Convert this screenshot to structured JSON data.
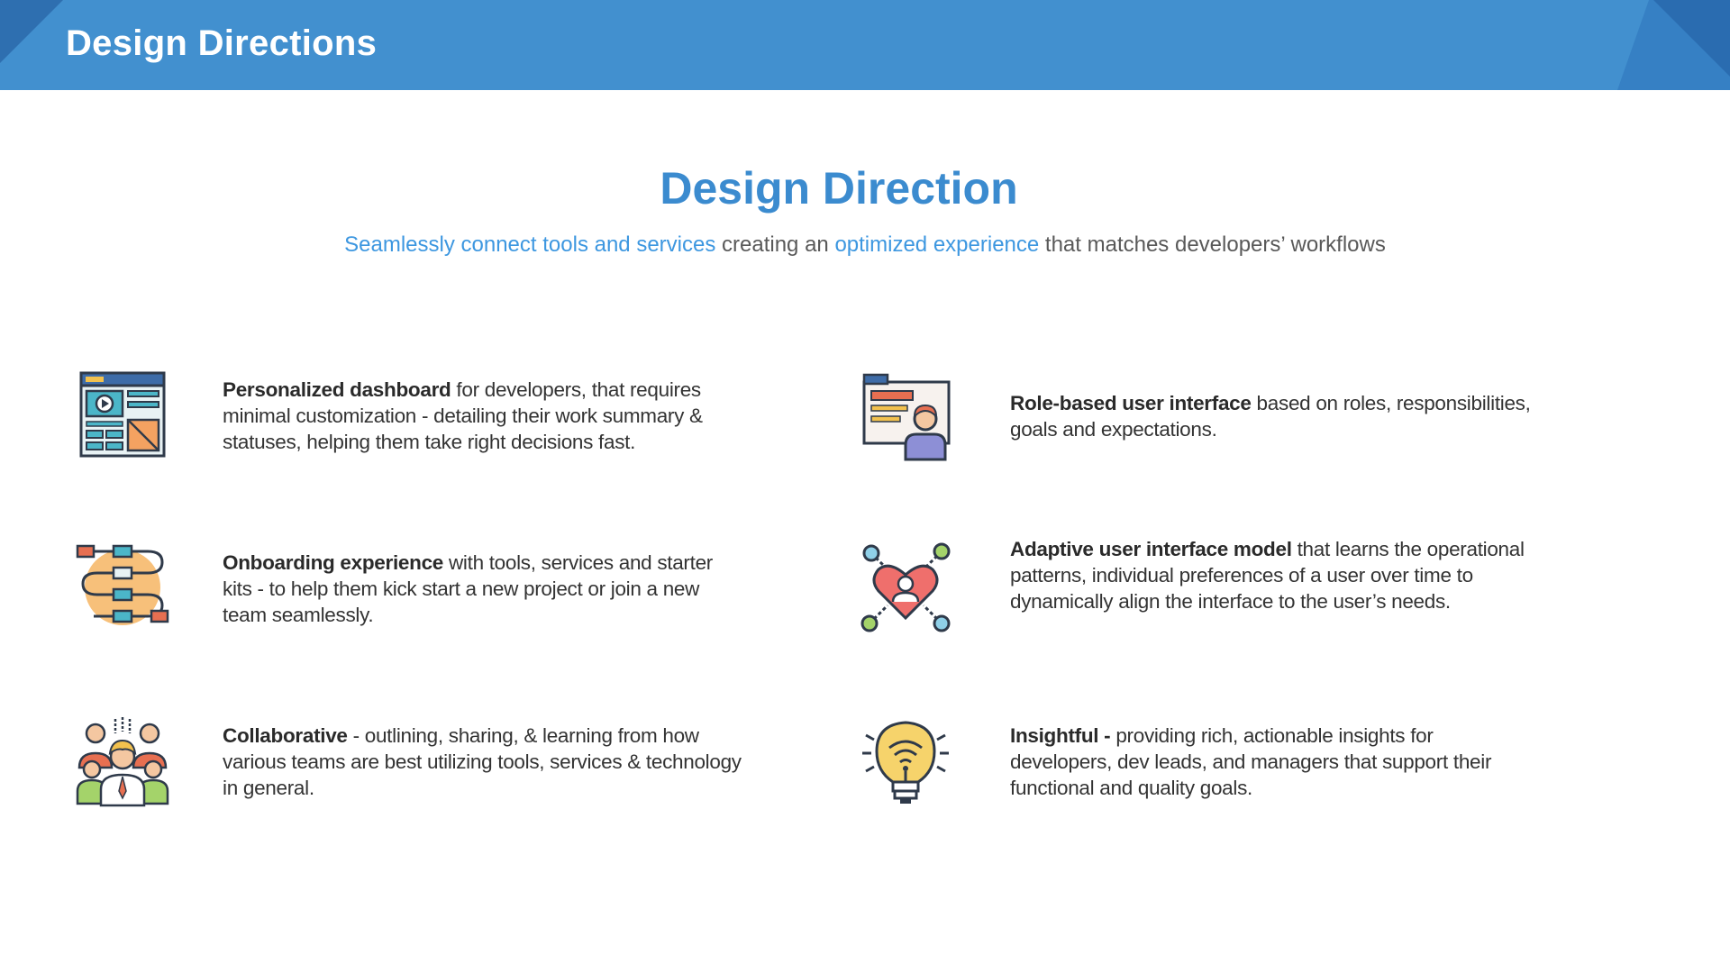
{
  "header": {
    "title": "Design Directions"
  },
  "main": {
    "title": "Design Direction",
    "subtitle": {
      "part1": "Seamlessly connect tools and services",
      "part2": " creating an ",
      "part3": "optimized experience",
      "part4": " that matches developers’ workflows"
    }
  },
  "colors": {
    "header_bg": "#4290cf",
    "title_blue": "#3b8bcf",
    "highlight_blue": "#3d97e0",
    "body_text": "#333333"
  },
  "items": [
    {
      "icon": "dashboard-icon",
      "title": "Personalized dashboard",
      "text": " for developers, that requires minimal customization - detailing their work summary & statuses, helping them take right decisions fast."
    },
    {
      "icon": "role-presentation-icon",
      "title": "Role-based user interface",
      "text": " based on roles, responsibilities, goals and expectations."
    },
    {
      "icon": "workflow-icon",
      "title": "Onboarding experience",
      "text": " with tools, services and starter kits - to help them kick start a new project or join a new team seamlessly."
    },
    {
      "icon": "heart-network-icon",
      "title": "Adaptive user interface model",
      "text": " that learns the operational patterns, individual preferences of a user over time to dynamically align the interface to the user’s needs."
    },
    {
      "icon": "team-icon",
      "title": "Collaborative",
      "text": " - outlining, sharing, & learning from how various teams are best utilizing tools, services & technology in general."
    },
    {
      "icon": "lightbulb-icon",
      "title": "Insightful -",
      "text": " providing rich, actionable insights for developers, dev leads, and managers that support their functional and quality goals."
    }
  ]
}
